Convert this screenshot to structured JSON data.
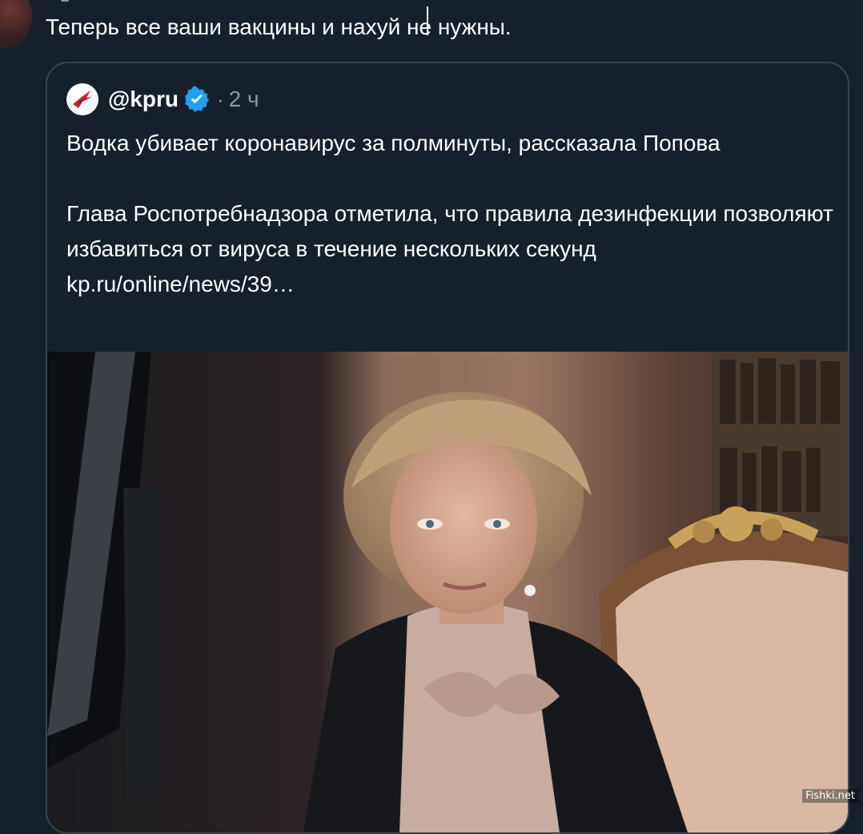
{
  "tweet": {
    "text": "Теперь все ваши вакцины и нахуй не нужны."
  },
  "quote": {
    "handle": "@kpru",
    "separator": "·",
    "time": "2 ч",
    "headline": "Водка убивает коронавирус за полминуты, рассказала Попова",
    "summary": "Глава Роспотребнадзора отметила, что правила дезинфекции позволяют избавиться от вируса в течение нескольких секунд",
    "link": "kp.ru/online/news/39…",
    "logo_icon": "kp-swallow-logo-icon",
    "verified_icon": "verified-badge-icon",
    "verified_color": "#1da1f2"
  },
  "photo": {
    "subject": "woman-at-desk-photo"
  },
  "watermark": "Fishki.net"
}
